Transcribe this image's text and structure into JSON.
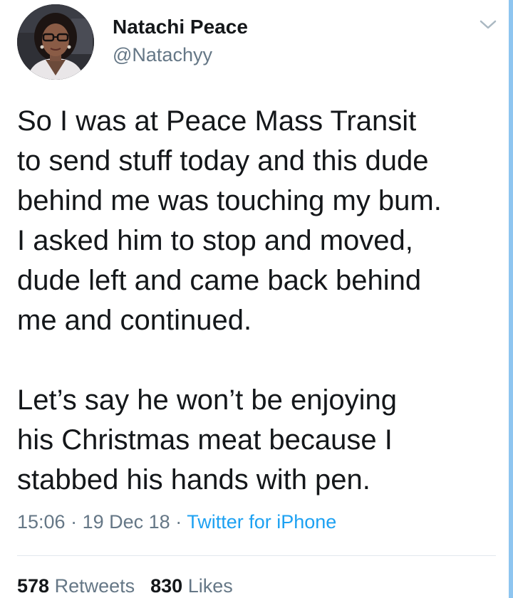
{
  "author": {
    "display_name": "Natachi Peace",
    "handle": "@Natachyy"
  },
  "tweet": {
    "paragraph_1_lines": [
      "So I was at Peace Mass Transit",
      "to send stuff today and this dude",
      "behind me was touching my bum.",
      "I asked him to stop and moved,",
      "dude left and came back behind",
      "me and continued."
    ],
    "paragraph_2_lines": [
      "Let’s say he won’t be enjoying",
      "his Christmas meat because I",
      "stabbed his hands with pen."
    ]
  },
  "meta": {
    "time": "15:06",
    "separator": "·",
    "date": "19 Dec 18",
    "source": "Twitter for iPhone"
  },
  "stats": {
    "retweets_count": "578",
    "retweets_label": "Retweets",
    "likes_count": "830",
    "likes_label": "Likes"
  },
  "icons": {
    "more_menu": "chevron-down-icon"
  },
  "colors": {
    "text": "#14171a",
    "secondary": "#657786",
    "link": "#1da1f2",
    "divider": "#e1e8ed",
    "accent_edge": "#8ec5f0"
  }
}
